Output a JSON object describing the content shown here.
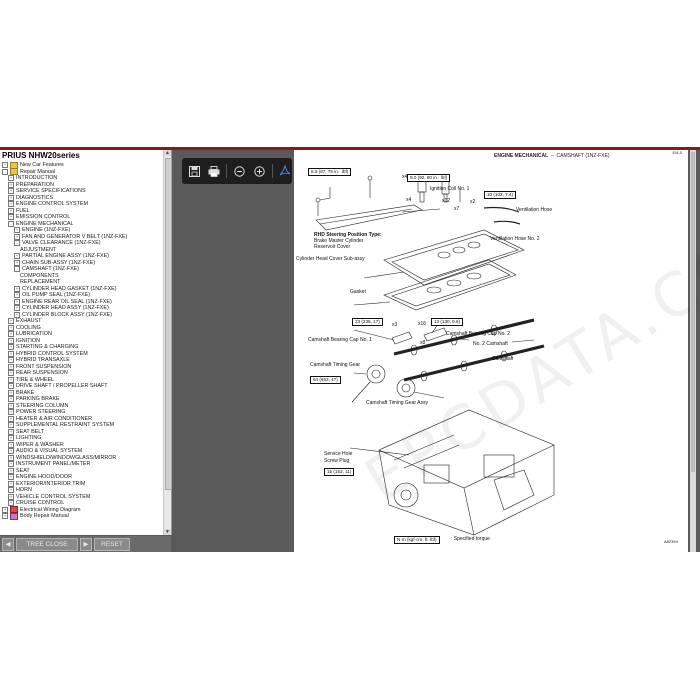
{
  "sidebar": {
    "title": "PRIUS NHW20series",
    "items": [
      {
        "label": "New Car Features",
        "level": 1,
        "expander": "+",
        "folder": "y"
      },
      {
        "label": "Repair Manual",
        "level": 1,
        "expander": "-",
        "folder": "y"
      },
      {
        "label": "INTRODUCTION",
        "level": 2,
        "expander": "+"
      },
      {
        "label": "PREPARATION",
        "level": 2,
        "expander": "+"
      },
      {
        "label": "SERVICE SPECIFICATIONS",
        "level": 2,
        "expander": "+"
      },
      {
        "label": "DIAGNOSTICS",
        "level": 2,
        "expander": "+"
      },
      {
        "label": "ENGINE CONTROL SYSTEM",
        "level": 2,
        "expander": "+"
      },
      {
        "label": "FUEL",
        "level": 2,
        "expander": "+"
      },
      {
        "label": "EMISSION CONTROL",
        "level": 2,
        "expander": "+"
      },
      {
        "label": "ENGINE MECHANICAL",
        "level": 2,
        "expander": "-"
      },
      {
        "label": "ENGINE (1NZ-FXE)",
        "level": 3,
        "expander": "+"
      },
      {
        "label": "FAN AND GENERATOR V BELT (1NZ-FXE)",
        "level": 3,
        "expander": "+"
      },
      {
        "label": "VALVE CLEARANCE (1NZ-FXE)",
        "level": 3,
        "expander": "-"
      },
      {
        "label": "ADJUSTMENT",
        "level": 4,
        "expander": ""
      },
      {
        "label": "PARTIAL ENGINE ASSY (1NZ-FXE)",
        "level": 3,
        "expander": "+"
      },
      {
        "label": "CHAIN SUB-ASSY (1NZ-FXE)",
        "level": 3,
        "expander": "+"
      },
      {
        "label": "CAMSHAFT (1NZ-FXE)",
        "level": 3,
        "expander": "-"
      },
      {
        "label": "COMPONENTS",
        "level": 4,
        "expander": ""
      },
      {
        "label": "REPLACEMENT",
        "level": 4,
        "expander": ""
      },
      {
        "label": "CYLINDER HEAD GASKET (1NZ-FXE)",
        "level": 3,
        "expander": "+"
      },
      {
        "label": "OIL PUMP SEAL (1NZ-FXE)",
        "level": 3,
        "expander": "+"
      },
      {
        "label": "ENGINE REAR OIL SEAL (1NZ-FXE)",
        "level": 3,
        "expander": "+"
      },
      {
        "label": "CYLINDER HEAD ASSY (1NZ-FXE)",
        "level": 3,
        "expander": "+"
      },
      {
        "label": "CYLINDER BLOCK ASSY (1NZ-FXE)",
        "level": 3,
        "expander": "+"
      },
      {
        "label": "EXHAUST",
        "level": 2,
        "expander": "+"
      },
      {
        "label": "COOLING",
        "level": 2,
        "expander": "+"
      },
      {
        "label": "LUBRICATION",
        "level": 2,
        "expander": "+"
      },
      {
        "label": "IGNITION",
        "level": 2,
        "expander": "+"
      },
      {
        "label": "STARTING & CHARGING",
        "level": 2,
        "expander": "+"
      },
      {
        "label": "HYBRID CONTROL SYSTEM",
        "level": 2,
        "expander": "+"
      },
      {
        "label": "HYBRID TRANSAXLE",
        "level": 2,
        "expander": "+"
      },
      {
        "label": "FRONT SUSPENSION",
        "level": 2,
        "expander": "+"
      },
      {
        "label": "REAR SUSPENSION",
        "level": 2,
        "expander": "+"
      },
      {
        "label": "TIRE & WHEEL",
        "level": 2,
        "expander": "+"
      },
      {
        "label": "DRIVE SHAFT / PROPELLER SHAFT",
        "level": 2,
        "expander": "+"
      },
      {
        "label": "BRAKE",
        "level": 2,
        "expander": "+"
      },
      {
        "label": "PARKING BRAKE",
        "level": 2,
        "expander": "+"
      },
      {
        "label": "STEERING COLUMN",
        "level": 2,
        "expander": "+"
      },
      {
        "label": "POWER STEERING",
        "level": 2,
        "expander": "+"
      },
      {
        "label": "HEATER & AIR CONDITIONER",
        "level": 2,
        "expander": "+"
      },
      {
        "label": "SUPPLEMENTAL RESTRAINT SYSTEM",
        "level": 2,
        "expander": "+"
      },
      {
        "label": "SEAT BELT",
        "level": 2,
        "expander": "+"
      },
      {
        "label": "LIGHTING",
        "level": 2,
        "expander": "+"
      },
      {
        "label": "WIPER & WASHER",
        "level": 2,
        "expander": "+"
      },
      {
        "label": "AUDIO & VISUAL SYSTEM",
        "level": 2,
        "expander": "+"
      },
      {
        "label": "WINDSHIELD/WINDOWGLASS/MIRROR",
        "level": 2,
        "expander": "+"
      },
      {
        "label": "INSTRUMENT PANEL/METER",
        "level": 2,
        "expander": "+"
      },
      {
        "label": "SEAT",
        "level": 2,
        "expander": "+"
      },
      {
        "label": "ENGINE HOOD/DOOR",
        "level": 2,
        "expander": "+"
      },
      {
        "label": "EXTERIOR/INTERIOR TRIM",
        "level": 2,
        "expander": "+"
      },
      {
        "label": "HORN",
        "level": 2,
        "expander": "+"
      },
      {
        "label": "VEHICLE CONTROL SYSTEM",
        "level": 2,
        "expander": "+"
      },
      {
        "label": "CRUISE CONTROL",
        "level": 2,
        "expander": "+"
      },
      {
        "label": "Electrical Wiring Diagram",
        "level": 1,
        "expander": "+",
        "folder": "r"
      },
      {
        "label": "Body Repair Manual",
        "level": 1,
        "expander": "+",
        "folder": "p"
      }
    ]
  },
  "bottombar": {
    "tree_close": "TREE CLOSE",
    "reset": "RESET",
    "prev_arrow": "◀",
    "next_arrow": "▶"
  },
  "toolbar": {
    "icons": [
      "save-icon",
      "print-icon",
      "zoom-out-icon",
      "zoom-in-icon",
      "acrobat-icon"
    ]
  },
  "document": {
    "header_section": "ENGINE MECHANICAL",
    "header_dash": "–",
    "header_sub": "CAMSHAFT (1NZ-FXE)",
    "page_ref": "EM-5",
    "watermark": "EPCDATA.COM",
    "figure_code": "A82394",
    "labels": {
      "ignition_coil": "Ignition Coil No. 1",
      "ventilation_hose": "Ventilation Hose",
      "ventilation_hose2": "Ventilation Hose No. 2",
      "rhd_title": "RHD Steering Position Type:",
      "rhd_line1": "Brake Master Cylinder",
      "rhd_line2": "Reservoir Cover",
      "head_cover": "Cylinder Head Cover Sub-assy",
      "gasket": "Gasket",
      "bearing_cap2": "Camshaft Bearing Cap No. 2",
      "bearing_cap1": "Camshaft Bearing Cap No. 1",
      "camshaft2": "No. 2 Camshaft",
      "camshaft": "Camshaft",
      "timing_gear": "Camshaft Timing Gear",
      "timing_gear_assy": "Camshaft Timing Gear Assy",
      "service_hole": "Service Hole",
      "screw_plug": "Screw Plug",
      "x4a": "x4",
      "x12": "x12",
      "x2": "x2",
      "x7": "x7",
      "x4b": "x4",
      "x3": "x3",
      "x16": "x16",
      "x8": "x8"
    },
    "torques": {
      "t1": "8.5 (87, 75 in.· lbf)",
      "t2": "9.0 (92, 80 in.· lbf)",
      "t3": "10 (102, 7.4)",
      "t4": "23 (235, 17)",
      "t5": "13 (130, 9.6)",
      "t6": "64 (653, 47)",
      "t7": "15 (153, 11)",
      "legend": "N·m (kgf·cm, ft.·lbf)",
      "legend_text": ": Specified torque"
    }
  }
}
